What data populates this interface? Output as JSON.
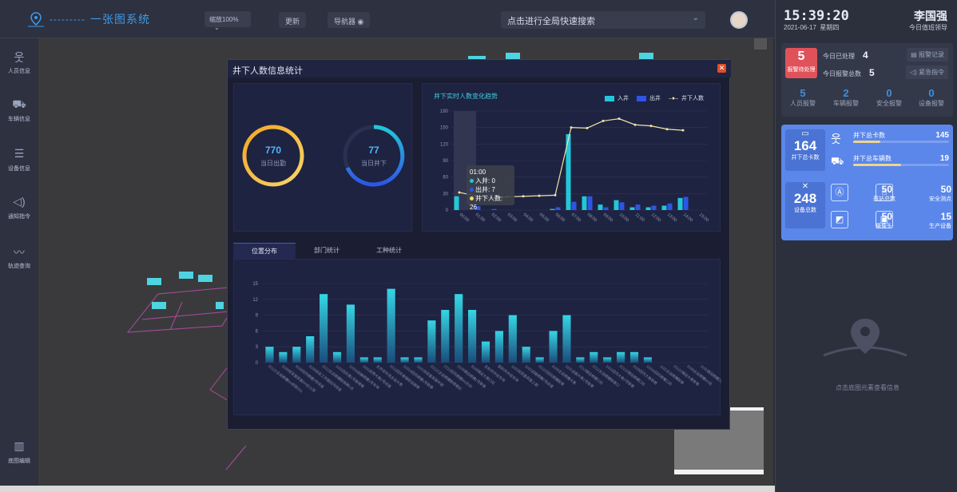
{
  "header": {
    "app_title": "一张图系统",
    "zoom_select": "缩放100%",
    "refresh_label": "更新",
    "navigator_label": "导航器",
    "search_placeholder": "点击进行全局快速搜索"
  },
  "left_nav": [
    {
      "label": "人员信息",
      "icon": "person-icon"
    },
    {
      "label": "车辆信息",
      "icon": "car-icon"
    },
    {
      "label": "设备信息",
      "icon": "device-icon"
    },
    {
      "label": "通知指令",
      "icon": "speaker-icon"
    },
    {
      "label": "轨迹查询",
      "icon": "trend-icon"
    },
    {
      "label": "底图编辑",
      "icon": "map-icon"
    }
  ],
  "right_panel": {
    "time": "15:39:20",
    "date": "2021-06-17",
    "weekday": "星期四",
    "user_name": "李国强",
    "user_role": "今日值班领导",
    "alarm_pending_count": "5",
    "alarm_pending_label": "报警待处理",
    "processed_label": "今日已处理",
    "processed_count": "4",
    "total_label": "今日报警总数",
    "total_count": "5",
    "record_link": "报警记录",
    "emergency_link": "紧急指令",
    "categories": [
      {
        "count": "5",
        "label": "人员报警"
      },
      {
        "count": "2",
        "label": "车辆报警"
      },
      {
        "count": "0",
        "label": "安全报警"
      },
      {
        "count": "0",
        "label": "设备报警"
      }
    ],
    "underground_cards_total": "164",
    "underground_cards_label": "井下总卡数",
    "card_count_label": "井下总卡数",
    "card_count_value": "145",
    "card_fill": 0.28,
    "vehicle_label": "井下总车辆数",
    "vehicle_value": "19",
    "vehicle_fill": 0.5,
    "device_total": "248",
    "device_total_label": "设备总数",
    "devices": [
      {
        "count": "50",
        "label": "基站总数",
        "icon": "antenna-icon"
      },
      {
        "count": "50",
        "label": "安全测点",
        "icon": "router-icon"
      },
      {
        "count": "50",
        "label": "摄像头",
        "icon": "camera-icon"
      },
      {
        "count": "15",
        "label": "生产设备",
        "icon": "machine-icon"
      }
    ],
    "empty_hint": "点击底图元素查看信息"
  },
  "modal": {
    "title": "井下人数信息统计",
    "attendance_count": "770",
    "attendance_label": "当日出勤",
    "down_count": "77",
    "down_label": "当日井下",
    "trend_title": "井下实时人数变化趋势",
    "legend_in": "入井",
    "legend_out": "出井",
    "legend_total": "井下人数",
    "tooltip_time": "01:00",
    "tooltip_in": "入井: 0",
    "tooltip_out": "出井: 7",
    "tooltip_total": "井下人数: 26",
    "tabs": [
      "位置分布",
      "部门统计",
      "工种统计"
    ]
  },
  "colors": {
    "accent": "#3a9bea",
    "cyan": "#22c7d9",
    "blue": "#2e55e6",
    "line": "#f2e3a6",
    "alarm": "#e0525a",
    "panel": "#5b87ea"
  },
  "chart_data": [
    {
      "type": "bar",
      "title": "井下实时人数变化趋势",
      "categories": [
        "00:00",
        "01:00",
        "02:00",
        "03:00",
        "04:00",
        "05:00",
        "06:00",
        "07:00",
        "08:00",
        "09:00",
        "10:00",
        "11:00",
        "12:00",
        "13:00",
        "14:00",
        "15:00"
      ],
      "series": [
        {
          "name": "入井",
          "type": "bar",
          "values": [
            25,
            0,
            0,
            0,
            0,
            0,
            2,
            138,
            25,
            10,
            18,
            5,
            5,
            8,
            22,
            0
          ]
        },
        {
          "name": "出井",
          "type": "bar",
          "values": [
            0,
            7,
            2,
            0,
            0,
            0,
            5,
            15,
            25,
            5,
            14,
            10,
            8,
            12,
            24,
            0
          ]
        },
        {
          "name": "井下人数",
          "type": "line",
          "values": [
            32,
            26,
            22,
            24,
            25,
            26,
            27,
            150,
            149,
            162,
            166,
            155,
            153,
            147,
            145,
            0
          ]
        }
      ],
      "ylim": [
        0,
        180
      ],
      "yticks": [
        0,
        30,
        60,
        90,
        120,
        150,
        180
      ]
    },
    {
      "type": "bar",
      "title": "位置分布",
      "categories": [
        "22122主运顺槽0m桥联201",
        "3109综采面采面0m处11架",
        "3109回风顺槽2号绕道",
        "3109综采工作面回风绕道",
        "2212主运顺槽联络巷2点",
        "1102回风巷1号联络巷",
        "11016运输顺槽1号车场",
        "1101皮带大巷2号绕道",
        "主井底车场主运大巷",
        "2212回风巷辅助运输巷",
        "11014回风顺槽1号联巷",
        "1101综采面采面中部",
        "22122主运顺槽联络巷处",
        "2212回风顺槽0m处30",
        "3109辅运顺槽1号联巷",
        "3109辅运大巷口处",
        "主斜井井底车场",
        "副斜井井底车场",
        "1102综采面采面上部",
        "1102运输顺槽2号绕道",
        "22122回风顺槽联巷",
        "3109主运顺槽大巷",
        "1101运输大巷1号联巷",
        "2212辅运顺槽口处",
        "2212主运顺槽联巷口",
        "1101回风大巷2号联巷",
        "22122辅运顺槽口处",
        "3109回风大巷联巷",
        "11016回风顺槽口处",
        "1102主运顺槽联巷",
        "22122辅运大巷联巷",
        "3109主运顺槽0m处",
        "1101辅运顺槽口处"
      ],
      "values": [
        3,
        2,
        3,
        5,
        13,
        2,
        11,
        1,
        1,
        14,
        1,
        1,
        8,
        10,
        13,
        10,
        4,
        6,
        9,
        3,
        1,
        6,
        9,
        1,
        2,
        1,
        2,
        2,
        1,
        0,
        0,
        0,
        0
      ],
      "ylim": [
        0,
        15
      ],
      "yticks": [
        0,
        3,
        6,
        9,
        12,
        15
      ]
    }
  ]
}
